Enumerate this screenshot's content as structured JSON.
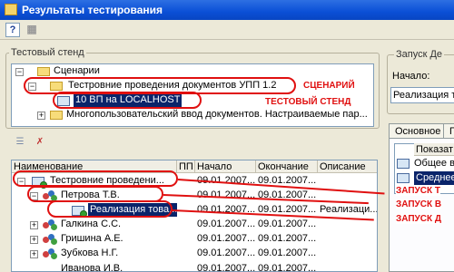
{
  "window": {
    "title": "Результаты тестирования"
  },
  "toolbar": {
    "help_label": "?"
  },
  "left_top": {
    "group_caption": "Тестовый стенд",
    "tree": [
      {
        "label": "Сценарии"
      },
      {
        "label": "Тестровние проведения документов УПП 1.2"
      },
      {
        "label": "10 ВП на LOCALHOST"
      },
      {
        "label": "Многопользовательский ввод документов. Настраиваемые пар..."
      }
    ]
  },
  "left_bottom": {
    "columns": [
      "Наименование",
      "ПП",
      "Начало",
      "Окончание",
      "Описание"
    ],
    "rows": [
      {
        "name": "Тестровние проведени...",
        "start": "09.01.2007...",
        "end": "09.01.2007...",
        "desc": ""
      },
      {
        "name": "Петрова Т.В.",
        "start": "09.01.2007...",
        "end": "09.01.2007...",
        "desc": ""
      },
      {
        "name": "Реализация това...",
        "start": "09.01.2007...",
        "end": "09.01.2007...",
        "desc": "Реализаци..."
      },
      {
        "name": "Галкина С.С.",
        "start": "09.01.2007...",
        "end": "09.01.2007...",
        "desc": ""
      },
      {
        "name": "Гришина А.Е.",
        "start": "09.01.2007...",
        "end": "09.01.2007...",
        "desc": ""
      },
      {
        "name": "Зубкова Н.Г.",
        "start": "09.01.2007...",
        "end": "09.01.2007...",
        "desc": ""
      },
      {
        "name": "Иванова И.В.",
        "start": "09.01.2007...",
        "end": "09.01.2007...",
        "desc": ""
      }
    ]
  },
  "right": {
    "group_caption": "Запуск Де",
    "start_label": "Начало:",
    "start_value": "Реализация т",
    "tabs": [
      "Основное",
      "П"
    ],
    "col_header": "Показат",
    "rows": [
      "Общее в",
      "Среднее"
    ]
  },
  "annotations": {
    "scenario": "СЦЕНАРИЙ",
    "stand": "ТЕСТОВЫЙ СТЕНД",
    "launch1": "ЗАПУСК Т",
    "launch2": "ЗАПУСК В",
    "launch3": "ЗАПУСК Д"
  },
  "colors": {
    "annotation": "#e01010",
    "selection": "#0a246a",
    "titlebar": "#0a4fd6"
  }
}
